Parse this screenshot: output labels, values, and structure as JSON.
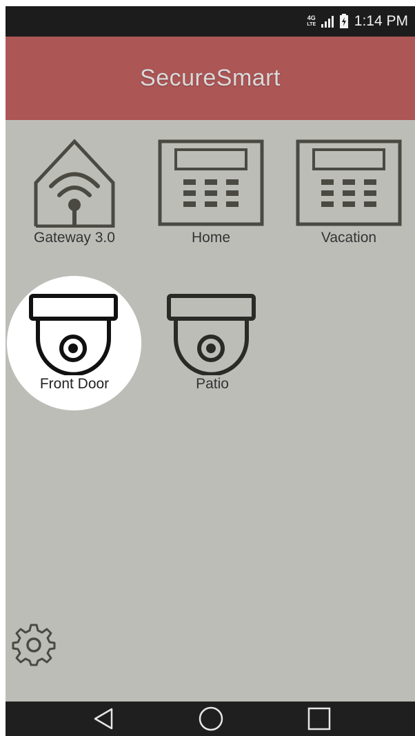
{
  "status_bar": {
    "network_type": "4G LTE",
    "time": "1:14 PM",
    "signal_icon": "signal-bars-icon",
    "battery_icon": "battery-charging-icon"
  },
  "app_bar": {
    "title": "SecureSmart",
    "background_color": "#ad5656"
  },
  "devices": [
    {
      "label": "Gateway 3.0",
      "icon": "wifi-house-icon"
    },
    {
      "label": "Home",
      "icon": "keypad-icon"
    },
    {
      "label": "Vacation",
      "icon": "keypad-icon"
    },
    {
      "label": "Front Door",
      "icon": "dome-camera-icon",
      "highlighted": true
    },
    {
      "label": "Patio",
      "icon": "dome-camera-icon"
    }
  ],
  "settings": {
    "icon": "gear-icon"
  },
  "nav_bar": {
    "back_icon": "back-triangle-icon",
    "home_icon": "home-circle-icon",
    "recents_icon": "recents-square-icon"
  }
}
